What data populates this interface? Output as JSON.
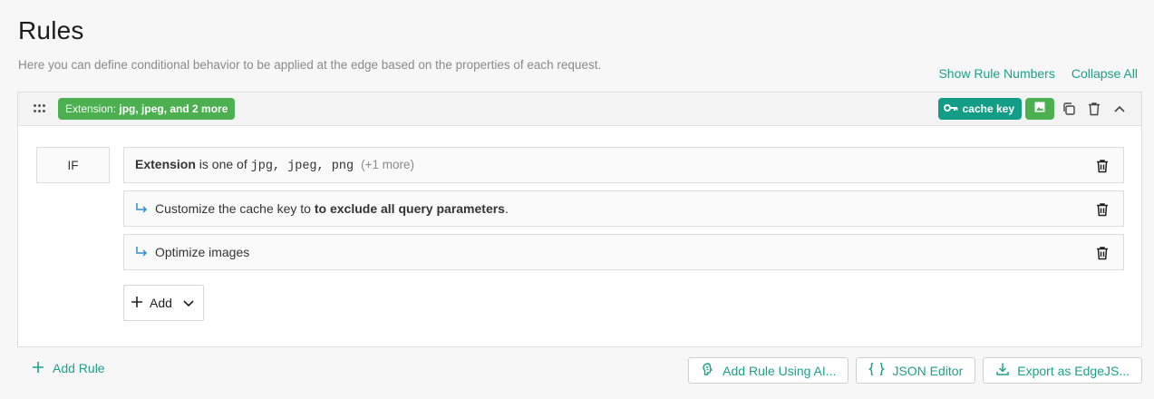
{
  "page": {
    "title": "Rules",
    "subtitle": "Here you can define conditional behavior to be applied at the edge based on the properties of each request."
  },
  "top_links": {
    "show_rule_numbers": "Show Rule Numbers",
    "collapse_all": "Collapse All"
  },
  "rule": {
    "badge_prefix": "Extension:",
    "badge_value": "jpg, jpeg, and 2 more",
    "cache_key_badge": "cache key",
    "condition_keyword": "IF",
    "condition": {
      "field": "Extension",
      "operator": "is one of",
      "values": "jpg, jpeg, png",
      "more": "(+1 more)"
    },
    "features": [
      {
        "text": "Customize the cache key to",
        "emphasis": "to exclude all query parameters",
        "suffix": "."
      },
      {
        "text": "Optimize images"
      }
    ],
    "add_label": "Add"
  },
  "bottom": {
    "add_rule": "Add Rule",
    "add_rule_ai": "Add Rule Using AI...",
    "json_editor": "JSON Editor",
    "export": "Export as EdgeJS..."
  },
  "icons": {
    "drag": "drag-handle-icon",
    "key": "key-icon",
    "image": "image-icon",
    "copy": "copy-icon",
    "trash": "trash-icon",
    "chevron_up": "chevron-up-icon",
    "arrow": "return-arrow-icon",
    "plus": "plus-icon",
    "chevron_down": "chevron-down-icon",
    "brain": "brain-icon",
    "braces": "braces-icon",
    "download": "download-icon"
  },
  "colors": {
    "accent": "#1ea08a",
    "green_badge": "#4caf50",
    "teal_badge": "#149d86"
  }
}
